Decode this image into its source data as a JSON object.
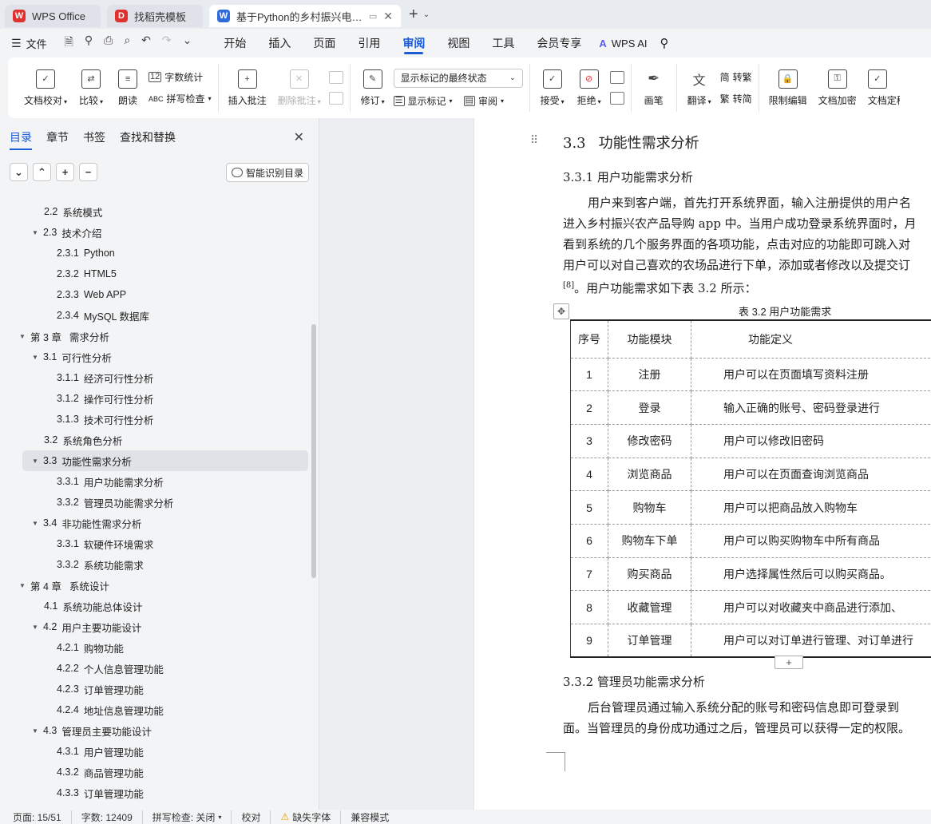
{
  "tabs": [
    {
      "title": "WPS Office",
      "logo": "W",
      "color": "#e0302d"
    },
    {
      "title": "找稻壳模板",
      "logo": "D",
      "color": "#e0302d"
    },
    {
      "title": "基于Python的乡村振兴电商导购",
      "logo": "W",
      "color": "#2f6bdc"
    }
  ],
  "menubar": {
    "file": "文件",
    "items": [
      "开始",
      "插入",
      "页面",
      "引用",
      "审阅",
      "视图",
      "工具",
      "会员专享"
    ],
    "active": "审阅",
    "ai": "WPS AI"
  },
  "ribbon": {
    "doc_check": "文档校对",
    "compare": "比较",
    "read": "朗读",
    "word_count": "字数统计",
    "spell_check": "拼写检查",
    "insert_comment": "插入批注",
    "delete_comment": "删除批注",
    "revise": "修订",
    "display_state": "显示标记的最终状态",
    "show_marks": "显示标记",
    "review": "审阅",
    "accept": "接受",
    "reject": "拒绝",
    "pen": "画笔",
    "translate": "翻译",
    "to_traditional": "转繁",
    "to_simplified": "转简",
    "restrict_edit": "限制编辑",
    "encrypt": "文档加密",
    "finalize": "文档定稿"
  },
  "nav": {
    "tabs": [
      "目录",
      "章节",
      "书签",
      "查找和替换"
    ],
    "smart_toc": "智能识别目录",
    "items": [
      {
        "num": "2.2",
        "text": "系统模式",
        "level": 2,
        "arrow": ""
      },
      {
        "num": "2.3",
        "text": "技术介绍",
        "level": 2,
        "arrow": "▼"
      },
      {
        "num": "2.3.1",
        "text": "Python",
        "level": 3,
        "arrow": ""
      },
      {
        "num": "2.3.2",
        "text": "HTML5",
        "level": 3,
        "arrow": ""
      },
      {
        "num": "2.3.3",
        "text": "Web APP",
        "level": 3,
        "arrow": ""
      },
      {
        "num": "2.3.4",
        "text": "MySQL 数据库",
        "level": 3,
        "arrow": ""
      },
      {
        "num": "第 3 章",
        "text": "需求分析",
        "level": 1,
        "arrow": "▼"
      },
      {
        "num": "3.1",
        "text": "可行性分析",
        "level": 2,
        "arrow": "▼"
      },
      {
        "num": "3.1.1",
        "text": "经济可行性分析",
        "level": 3,
        "arrow": ""
      },
      {
        "num": "3.1.2",
        "text": "操作可行性分析",
        "level": 3,
        "arrow": ""
      },
      {
        "num": "3.1.3",
        "text": "技术可行性分析",
        "level": 3,
        "arrow": ""
      },
      {
        "num": "3.2",
        "text": "系统角色分析",
        "level": 2,
        "arrow": ""
      },
      {
        "num": "3.3",
        "text": "功能性需求分析",
        "level": 2,
        "arrow": "▼",
        "selected": true
      },
      {
        "num": "3.3.1",
        "text": "用户功能需求分析",
        "level": 3,
        "arrow": ""
      },
      {
        "num": "3.3.2",
        "text": "管理员功能需求分析",
        "level": 3,
        "arrow": ""
      },
      {
        "num": "3.4",
        "text": "非功能性需求分析",
        "level": 2,
        "arrow": "▼"
      },
      {
        "num": "3.3.1",
        "text": "软硬件环境需求",
        "level": 3,
        "arrow": ""
      },
      {
        "num": "3.3.2",
        "text": "系统功能需求",
        "level": 3,
        "arrow": ""
      },
      {
        "num": "第 4 章",
        "text": "系统设计",
        "level": 1,
        "arrow": "▼"
      },
      {
        "num": "4.1",
        "text": "系统功能总体设计",
        "level": 2,
        "arrow": ""
      },
      {
        "num": "4.2",
        "text": "用户主要功能设计",
        "level": 2,
        "arrow": "▼"
      },
      {
        "num": "4.2.1",
        "text": "购物功能",
        "level": 3,
        "arrow": ""
      },
      {
        "num": "4.2.2",
        "text": "个人信息管理功能",
        "level": 3,
        "arrow": ""
      },
      {
        "num": "4.2.3",
        "text": "订单管理功能",
        "level": 3,
        "arrow": ""
      },
      {
        "num": "4.2.4",
        "text": "地址信息管理功能",
        "level": 3,
        "arrow": ""
      },
      {
        "num": "4.3",
        "text": "管理员主要功能设计",
        "level": 2,
        "arrow": "▼"
      },
      {
        "num": "4.3.1",
        "text": "用户管理功能",
        "level": 3,
        "arrow": ""
      },
      {
        "num": "4.3.2",
        "text": "商品管理功能",
        "level": 3,
        "arrow": ""
      },
      {
        "num": "4.3.3",
        "text": "订单管理功能",
        "level": 3,
        "arrow": ""
      }
    ]
  },
  "doc": {
    "h_num": "3.3",
    "h_title": "功能性需求分析",
    "h3_1": "3.3.1  用户功能需求分析",
    "p1_lines": [
      "用户来到客户端，首先打开系统界面，输入注册提供的用户名",
      "进入乡村振兴农产品导购 app 中。当用户成功登录系统界面时，月",
      "看到系统的几个服务界面的各项功能，点击对应的功能即可跳入对",
      "用户可以对自己喜欢的农场品进行下单，添加或者修改以及提交订"
    ],
    "p1_cite": "[8]",
    "p1_tail": "。用户功能需求如下表 3.2 所示：",
    "caption": "表 3.2  用户功能需求",
    "table_headers": [
      "序号",
      "功能模块",
      "功能定义"
    ],
    "table_rows": [
      [
        "1",
        "注册",
        "用户可以在页面填写资料注册"
      ],
      [
        "2",
        "登录",
        "输入正确的账号、密码登录进行"
      ],
      [
        "3",
        "修改密码",
        "用户可以修改旧密码"
      ],
      [
        "4",
        "浏览商品",
        "用户可以在页面查询浏览商品"
      ],
      [
        "5",
        "购物车",
        "用户可以把商品放入购物车"
      ],
      [
        "6",
        "购物车下单",
        "用户可以购买购物车中所有商品"
      ],
      [
        "7",
        "购买商品",
        "用户选择属性然后可以购买商品。"
      ],
      [
        "8",
        "收藏管理",
        "用户可以对收藏夹中商品进行添加、 "
      ],
      [
        "9",
        "订单管理",
        "用户可以对订单进行管理、对订单进行"
      ]
    ],
    "h3_2": "3.3.2  管理员功能需求分析",
    "p2_lines": [
      "后台管理员通过输入系统分配的账号和密码信息即可登录到",
      "面。当管理员的身份成功通过之后，管理员可以获得一定的权限。"
    ]
  },
  "status": {
    "page": "页面: 15/51",
    "words": "字数: 12409",
    "spell": "拼写检查: 关闭",
    "proof": "校对",
    "missing_font": "缺失字体",
    "compat": "兼容模式"
  }
}
